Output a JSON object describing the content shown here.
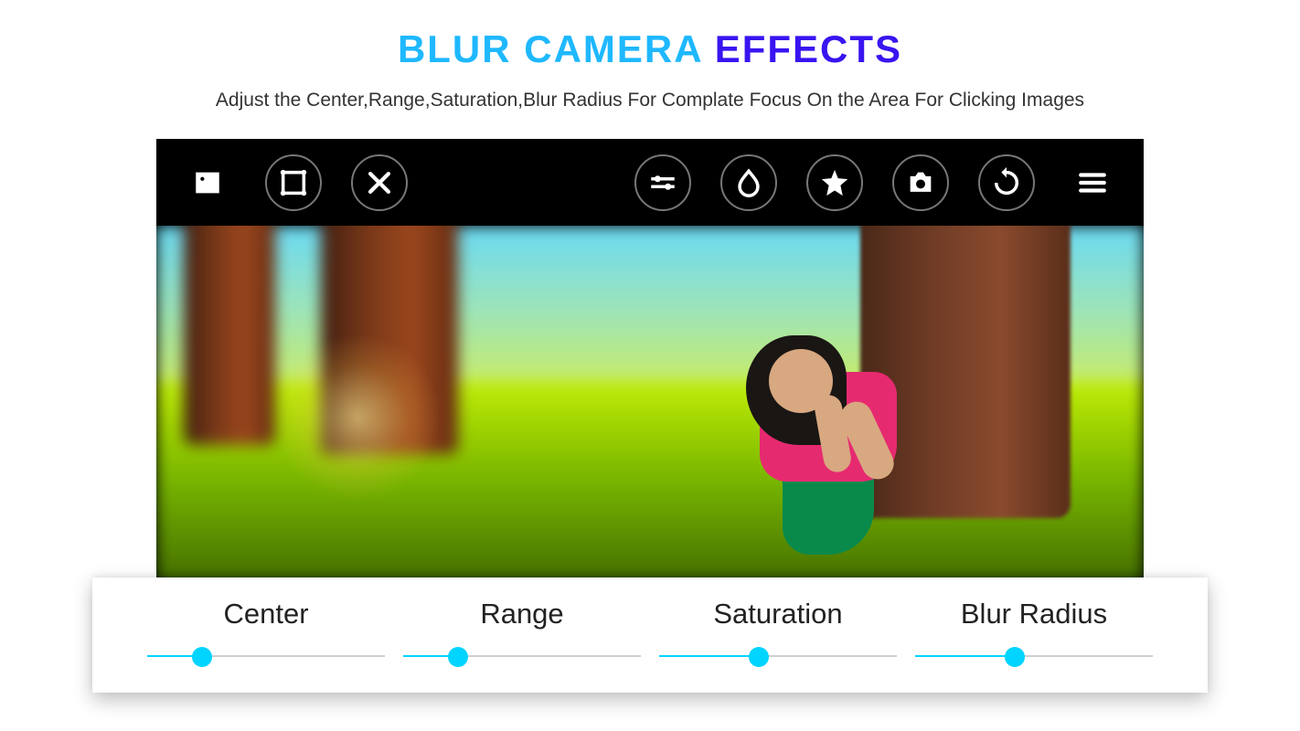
{
  "title": {
    "part1": "BLUR CAMERA ",
    "part2": "EFFECTS"
  },
  "subtitle": "Adjust the Center,Range,Saturation,Blur Radius For Complate Focus On the Area For Clicking Images",
  "toolbar": {
    "gallery": "gallery",
    "crop": "crop",
    "close": "close",
    "adjust": "adjust",
    "droplet": "droplet",
    "star": "star",
    "camera": "camera",
    "refresh": "refresh",
    "menu": "menu"
  },
  "sliders": [
    {
      "label": "Center",
      "value": 23
    },
    {
      "label": "Range",
      "value": 23
    },
    {
      "label": "Saturation",
      "value": 42
    },
    {
      "label": "Blur Radius",
      "value": 42
    }
  ],
  "colors": {
    "accent": "#00d4ff",
    "title1": "#1fb8ff",
    "title2": "#3a14f0"
  }
}
